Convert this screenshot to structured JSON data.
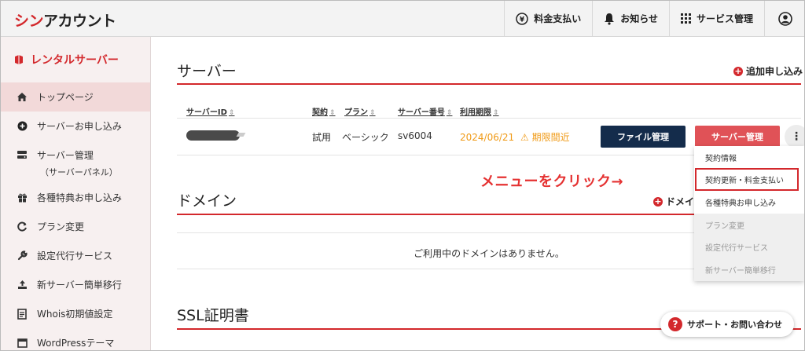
{
  "header": {
    "logo_red": "シン",
    "logo_dark": "アカウント",
    "nav": [
      {
        "label": "料金支払い",
        "icon": "yen-icon"
      },
      {
        "label": "お知らせ",
        "icon": "bell-icon"
      },
      {
        "label": "サービス管理",
        "icon": "grid-icon"
      }
    ],
    "account_icon": "user-circle-icon"
  },
  "sidebar": {
    "title": "レンタルサーバー",
    "items": [
      {
        "label": "トップページ",
        "icon": "home-icon",
        "active": true
      },
      {
        "label": "サーバーお申し込み",
        "icon": "plus-circle-icon"
      },
      {
        "label": "サーバー管理",
        "sub": "（サーバーパネル）",
        "icon": "server-icon"
      },
      {
        "label": "各種特典お申し込み",
        "icon": "gift-icon"
      },
      {
        "label": "プラン変更",
        "icon": "refresh-icon"
      },
      {
        "label": "設定代行サービス",
        "icon": "wrench-icon"
      },
      {
        "label": "新サーバー簡単移行",
        "icon": "upload-icon"
      },
      {
        "label": "Whois初期値設定",
        "icon": "document-icon"
      },
      {
        "label": "WordPressテーマ",
        "icon": "window-icon"
      }
    ]
  },
  "main": {
    "server_section": {
      "title": "サーバー",
      "add_label": "追加申し込み",
      "columns": [
        "サーバーID",
        "契約",
        "プラン",
        "サーバー番号",
        "利用期限"
      ],
      "row": {
        "contract": "試用",
        "plan": "ベーシック",
        "server_no": "sv6004",
        "expiry": "2024/06/21",
        "expiry_warning": "期限間近"
      },
      "file_button": "ファイル管理",
      "server_button": "サーバー管理",
      "menu_button": "⋮"
    },
    "domain_section": {
      "title": "ドメイン",
      "add_label": "ドメイ",
      "empty_message": "ご利用中のドメインはありません。"
    },
    "ssl_section": {
      "title": "SSL証明書"
    }
  },
  "dropdown": {
    "items": [
      {
        "label": "契約情報",
        "enabled": true
      },
      {
        "label": "契約更新・料金支払い",
        "enabled": true,
        "highlighted": true
      },
      {
        "label": "各種特典お申し込み",
        "enabled": true
      },
      {
        "label": "プラン変更",
        "enabled": false
      },
      {
        "label": "設定代行サービス",
        "enabled": false
      },
      {
        "label": "新サーバー簡単移行",
        "enabled": false
      }
    ]
  },
  "annotation": "メニューをクリック→",
  "support_button": "サポート・お問い合わせ",
  "colors": {
    "brand_red": "#d3282c",
    "navy": "#142c4b",
    "warning": "#f09a16"
  }
}
